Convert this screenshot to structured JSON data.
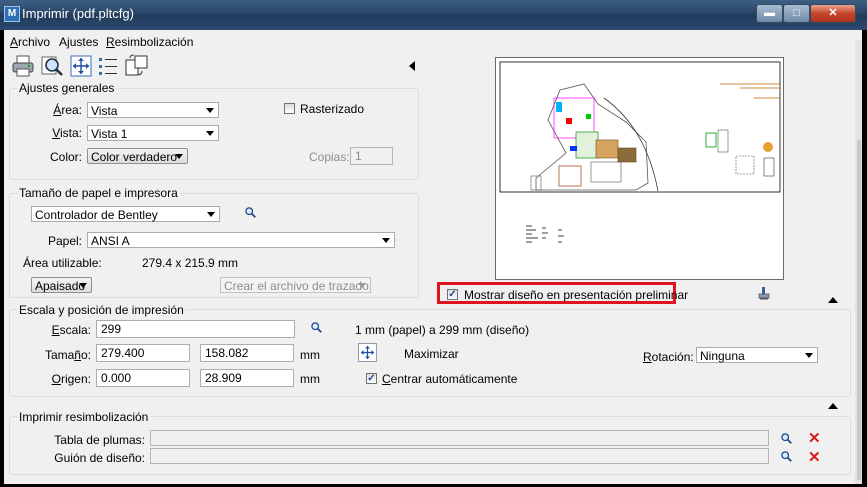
{
  "window": {
    "title": "Imprimir  (pdf.pltcfg)",
    "app_icon_letter": "M"
  },
  "menu": {
    "items": [
      {
        "label": "Archivo",
        "key": "A",
        "rest": "rchivo"
      },
      {
        "label": "Ajustes",
        "key": "j",
        "pre": "A",
        "rest": "ustes"
      },
      {
        "label": "Resimbolización",
        "key": "R",
        "rest": "esimbolización"
      }
    ]
  },
  "general": {
    "title": "Ajustes generales",
    "area_label": "Área:",
    "area_value": "Vista",
    "vista_label": "Vista:",
    "vista_value": "Vista 1",
    "color_label": "Color:",
    "color_value": "Color verdadero",
    "rasterizado_label": "Rasterizado",
    "copias_label": "Copias:",
    "copias_value": "1"
  },
  "paper": {
    "title": "Tamaño de papel e impresora",
    "driver_value": "Controlador de Bentley",
    "papel_label": "Papel:",
    "papel_value": "ANSI A",
    "area_util_label": "Área utilizable:",
    "area_util_value": "279.4 x 215.9 mm",
    "orientation_value": "Apaisado",
    "plotfile_value": "Crear el archivo de trazado"
  },
  "preview": {
    "show_label": "Mostrar diseño en presentación preliminar",
    "checked": true
  },
  "position": {
    "title": "Escala y posición de impresión",
    "escala_label": "Escala:",
    "escala_value": "299",
    "scale_note": "1 mm (papel) a 299 mm (diseño)",
    "tamano_label": "Tamaño:",
    "tamano_x": "279.400",
    "tamano_y": "158.082",
    "tamano_unit": "mm",
    "maximizar_label": "Maximizar",
    "origen_label": "Origen:",
    "origen_x": "0.000",
    "origen_y": "28.909",
    "origen_unit": "mm",
    "centrar_label": "Centrar automáticamente",
    "rotacion_label": "Rotación:",
    "rotacion_value": "Ninguna"
  },
  "resym": {
    "title": "Imprimir resimbolización",
    "tabla_label": "Tabla de plumas:",
    "tabla_value": "",
    "guion_label": "Guión de diseño:",
    "guion_value": ""
  },
  "colors": {
    "highlight": "#e0141e",
    "check": "#21409a",
    "titlebar": "#2a4566"
  }
}
